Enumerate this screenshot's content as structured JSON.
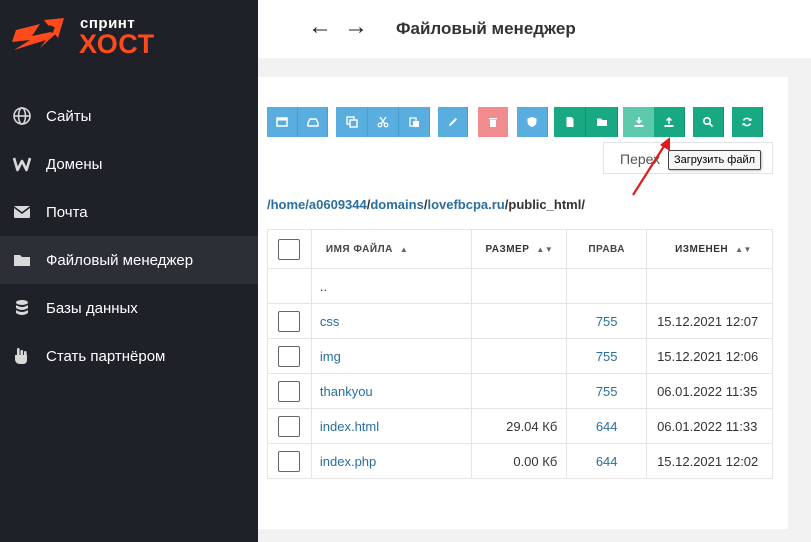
{
  "logo": {
    "small": "спринт",
    "big": "ХОСТ",
    "accent_color": "#ff4a1c"
  },
  "sidebar": {
    "items": [
      {
        "label": "Сайты",
        "icon": "globe-icon"
      },
      {
        "label": "Домены",
        "icon": "w-icon"
      },
      {
        "label": "Почта",
        "icon": "envelope-icon"
      },
      {
        "label": "Файловый менеджер",
        "icon": "folder-icon",
        "active": true
      },
      {
        "label": "Базы данных",
        "icon": "database-icon"
      },
      {
        "label": "Стать партнёром",
        "icon": "hand-icon"
      }
    ]
  },
  "header": {
    "back": "←",
    "forward": "→",
    "title": "Файловый менеджер"
  },
  "toolbar": {
    "buttons": [
      "select-all-icon",
      "deselect-icon",
      "copy-icon",
      "cut-icon",
      "paste-icon",
      "rename-icon",
      "delete-icon",
      "permissions-icon",
      "new-file-icon",
      "new-folder-icon",
      "download-icon",
      "upload-icon",
      "search-icon",
      "refresh-icon"
    ],
    "hint_partial": "Перех",
    "tooltip": "Загрузить файл"
  },
  "path": {
    "seg1": "/home/a0609344",
    "seg2": "domains",
    "seg3": "lovefbcpa.ru",
    "seg4": "public_html"
  },
  "table": {
    "headers": {
      "name": "ИМЯ ФАЙЛА",
      "size": "РАЗМЕР",
      "rights": "ПРАВА",
      "modified": "ИЗМЕНЕН"
    },
    "updir": "..",
    "rows": [
      {
        "name": "css",
        "size": "",
        "rights": "755",
        "modified": "15.12.2021 12:07"
      },
      {
        "name": "img",
        "size": "",
        "rights": "755",
        "modified": "15.12.2021 12:06"
      },
      {
        "name": "thankyou",
        "size": "",
        "rights": "755",
        "modified": "06.01.2022 11:35"
      },
      {
        "name": "index.html",
        "size": "29.04 Кб",
        "rights": "644",
        "modified": "06.01.2022 11:33"
      },
      {
        "name": "index.php",
        "size": "0.00 Кб",
        "rights": "644",
        "modified": "15.12.2021 12:02"
      }
    ]
  }
}
